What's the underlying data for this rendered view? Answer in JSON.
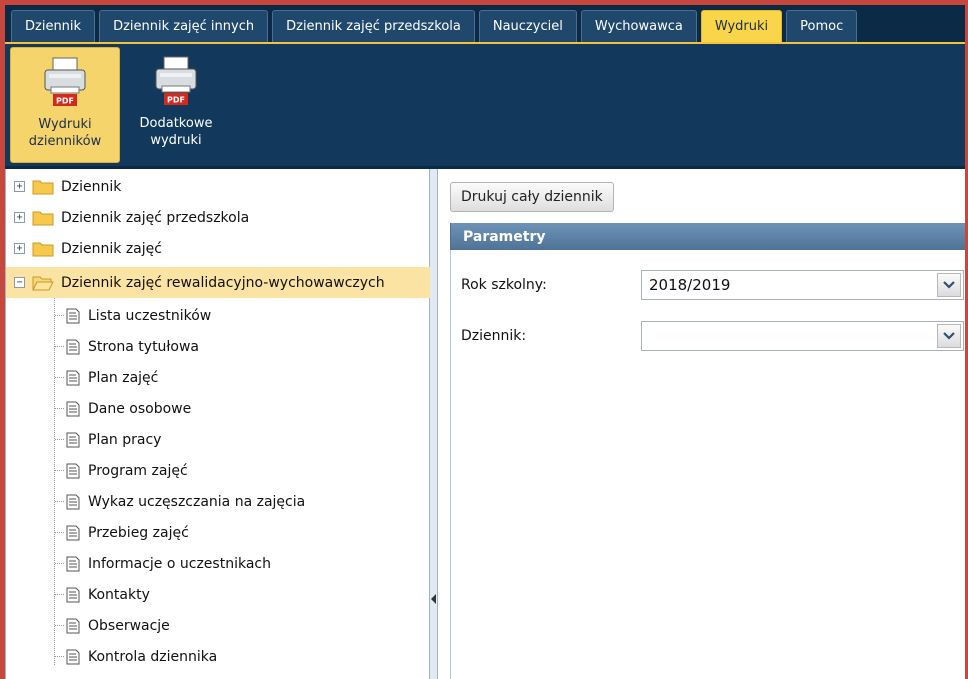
{
  "tabs": [
    {
      "label": "Dziennik",
      "active": false
    },
    {
      "label": "Dziennik zajęć innych",
      "active": false
    },
    {
      "label": "Dziennik zajęć przedszkola",
      "active": false
    },
    {
      "label": "Nauczyciel",
      "active": false
    },
    {
      "label": "Wychowawca",
      "active": false
    },
    {
      "label": "Wydruki",
      "active": true
    },
    {
      "label": "Pomoc",
      "active": false
    }
  ],
  "ribbon": {
    "buttons": [
      {
        "line1": "Wydruki",
        "line2": "dzienników",
        "icon": "pdf-printer-icon",
        "icon_text": "PDF",
        "active": true
      },
      {
        "line1": "Dodatkowe",
        "line2": "wydruki",
        "icon": "pdf-printer-icon",
        "icon_text": "PDF",
        "active": false
      }
    ]
  },
  "tree": {
    "folders": [
      {
        "label": "Dziennik",
        "expanded": false
      },
      {
        "label": "Dziennik zajęć przedszkola",
        "expanded": false
      },
      {
        "label": "Dziennik zajęć",
        "expanded": false
      },
      {
        "label": "Dziennik zajęć rewalidacyjno-wychowawczych",
        "expanded": true,
        "selected": true
      }
    ],
    "documents": [
      "Lista uczestników",
      "Strona tytułowa",
      "Plan zajęć",
      "Dane osobowe",
      "Plan pracy",
      "Program zajęć",
      "Wykaz uczęszczania na zajęcia",
      "Przebieg zajęć",
      "Informacje o uczestnikach",
      "Kontakty",
      "Obserwacje",
      "Kontrola dziennika"
    ]
  },
  "main": {
    "print_all_button": "Drukuj cały dziennik",
    "params_title": "Parametry",
    "fields": {
      "school_year_label": "Rok szkolny:",
      "school_year_value": "2018/2019",
      "journal_label": "Dziennik:",
      "journal_value": ""
    }
  },
  "colors": {
    "active_tab": "#f9d649",
    "tab_bg": "#1f486c",
    "ribbon_bg": "#12395c",
    "selected_row": "#fbe3a4",
    "params_header": "#5f83a7",
    "frame": "#c8473d"
  }
}
